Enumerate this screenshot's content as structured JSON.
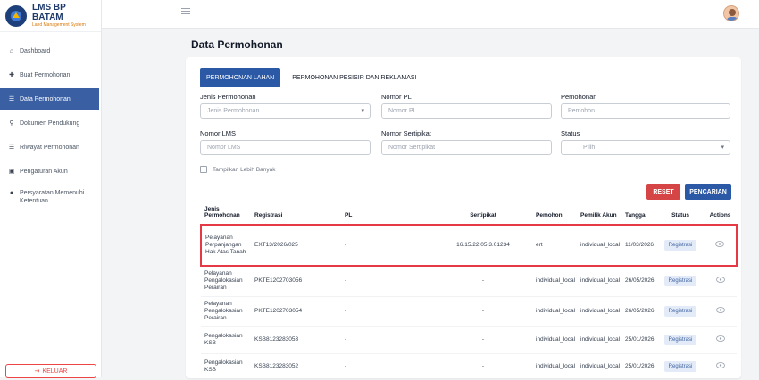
{
  "brand": {
    "title": "LMS BP BATAM",
    "subtitle": "Land Management System"
  },
  "sidebar": {
    "items": [
      {
        "label": "Dashboard",
        "icon": "home-icon"
      },
      {
        "label": "Buat Permohonan",
        "icon": "plus-icon"
      },
      {
        "label": "Data Permohonan",
        "icon": "list-icon",
        "active": true
      },
      {
        "label": "Dokumen Pendukung",
        "icon": "paperclip-icon"
      },
      {
        "label": "Riwayat Permohonan",
        "icon": "history-icon"
      },
      {
        "label": "Pengaturan Akun",
        "icon": "user-settings-icon"
      },
      {
        "label": "Persyaratan Memenuhi Ketentuan",
        "icon": "circle-icon"
      }
    ],
    "logout_label": "KELUAR"
  },
  "page": {
    "title": "Data Permohonan"
  },
  "tabs": [
    "PERMOHONAN LAHAN",
    "PERMOHONAN PESISIR DAN REKLAMASI"
  ],
  "filters": {
    "jenis": {
      "label": "Jenis Permohonan",
      "placeholder": "Jenis Permohonan"
    },
    "pl": {
      "label": "Nomor PL",
      "placeholder": "Nomor PL"
    },
    "pemohon": {
      "label": "Pemohonan",
      "placeholder": "Pemohon"
    },
    "lms": {
      "label": "Nomor LMS",
      "placeholder": "Nomor LMS"
    },
    "sertipikat": {
      "label": "Nomor Sertipikat",
      "placeholder": "Nomor Sertipikat"
    },
    "status": {
      "label": "Status",
      "value": "Pilih"
    },
    "checkbox_label": "Tampilkan Lebih Banyak"
  },
  "buttons": {
    "reset": "RESET",
    "search": "PENCARIAN"
  },
  "table": {
    "headers": [
      "Jenis Permohonan",
      "Registrasi",
      "PL",
      "Sertipikat",
      "Pemohon",
      "Pemilik Akun",
      "Tanggal",
      "Status",
      "Actions"
    ],
    "rows": [
      {
        "jenis": "Pelayanan Perpanjangan Hak Atas Tanah",
        "registrasi": "EXT13/2026/025",
        "pl": "-",
        "sertipikat": "16.15.22.05.3.01234",
        "pemohon": "ert",
        "pemilik": "individual_local",
        "tanggal": "11/03/2026",
        "status": "Registrasi",
        "highlight": true
      },
      {
        "jenis": "Pelayanan Pengalokasian Perairan",
        "registrasi": "PKTE1202703056",
        "pl": "-",
        "sertipikat": "-",
        "pemohon": "individual_local",
        "pemilik": "individual_local",
        "tanggal": "26/05/2026",
        "status": "Registrasi",
        "highlight": false
      },
      {
        "jenis": "Pelayanan Pengalokasian Perairan",
        "registrasi": "PKTE1202703054",
        "pl": "-",
        "sertipikat": "-",
        "pemohon": "individual_local",
        "pemilik": "individual_local",
        "tanggal": "26/05/2026",
        "status": "Registrasi",
        "highlight": false
      },
      {
        "jenis": "Pengalokasian KSB",
        "registrasi": "KSB8123283053",
        "pl": "-",
        "sertipikat": "-",
        "pemohon": "individual_local",
        "pemilik": "individual_local",
        "tanggal": "25/01/2026",
        "status": "Registrasi",
        "highlight": false
      },
      {
        "jenis": "Pengalokasian KSB",
        "registrasi": "KSB8123283052",
        "pl": "-",
        "sertipikat": "-",
        "pemohon": "individual_local",
        "pemilik": "individual_local",
        "tanggal": "25/01/2026",
        "status": "Registrasi",
        "highlight": false
      }
    ]
  },
  "colors": {
    "primary": "#2b59a6",
    "danger": "#d64545",
    "highlight": "#e63946",
    "sidebar_active": "#3a5fa3"
  }
}
